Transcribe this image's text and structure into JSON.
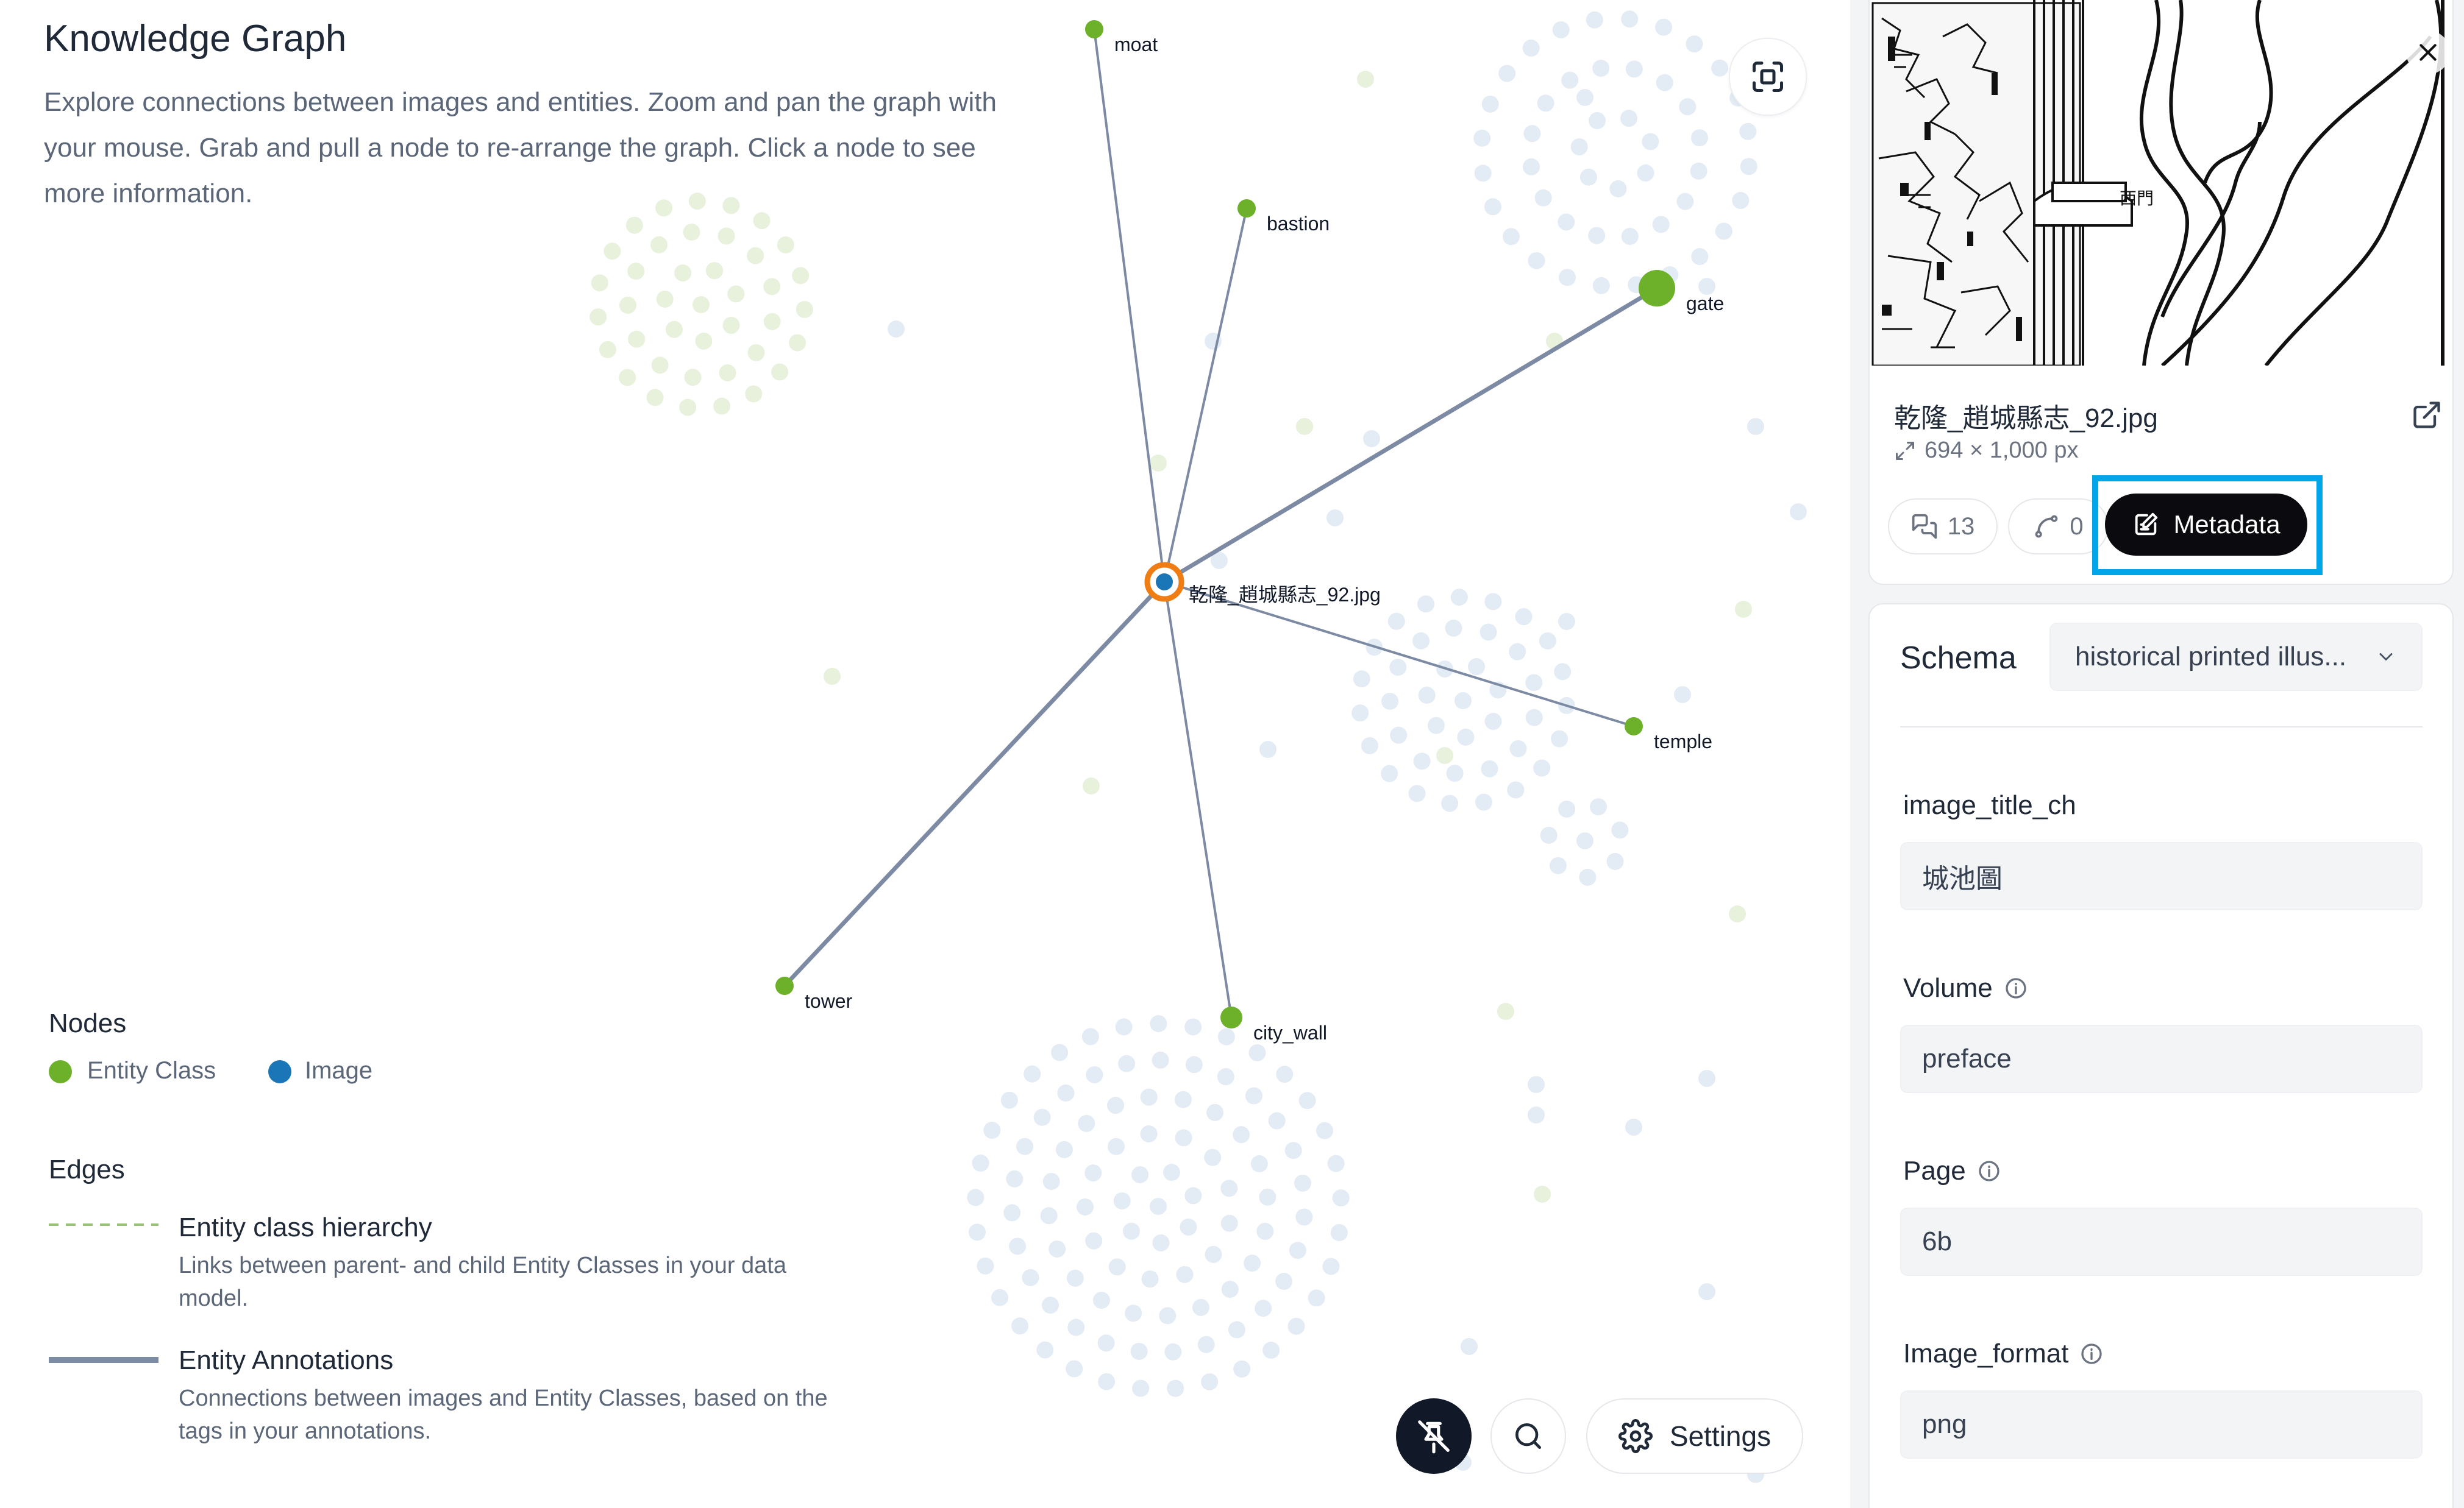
{
  "header": {
    "title": "Knowledge Graph",
    "description": "Explore connections between images and entities. Zoom and pan the graph with your mouse. Grab and pull a node to re-arrange the graph. Click a node to see more information."
  },
  "graph": {
    "center_node": {
      "label": "乾隆_趙城縣志_92.jpg",
      "type": "Image"
    },
    "entity_nodes": [
      {
        "label": "moat"
      },
      {
        "label": "bastion"
      },
      {
        "label": "gate"
      },
      {
        "label": "temple"
      },
      {
        "label": "city_wall"
      },
      {
        "label": "tower"
      }
    ]
  },
  "legend": {
    "nodes_heading": "Nodes",
    "entity_class_label": "Entity Class",
    "image_label": "Image",
    "edges_heading": "Edges",
    "hierarchy_title": "Entity class hierarchy",
    "hierarchy_desc": "Links between parent- and child Entity Classes in your data model.",
    "annotations_title": "Entity Annotations",
    "annotations_desc": "Connections between images and Entity Classes, based on the tags in your annotations."
  },
  "toolbar": {
    "settings_label": "Settings"
  },
  "image_panel": {
    "filename": "乾隆_趙城縣志_92.jpg",
    "dimensions": "694 × 1,000 px",
    "comments_count": "13",
    "relations_count": "0",
    "metadata_label": "Metadata"
  },
  "metadata": {
    "schema_label": "Schema",
    "schema_value": "historical printed illus...",
    "fields": [
      {
        "label": "image_title_ch",
        "value": "城池圖"
      },
      {
        "label": "Volume",
        "value": "preface"
      },
      {
        "label": "Page",
        "value": "6b"
      },
      {
        "label": "Image_format",
        "value": "png"
      }
    ]
  },
  "colors": {
    "entity_node": "#6db12a",
    "image_node": "#1b76b8",
    "selected_ring": "#f07d14",
    "edge": "#7d8aa3",
    "highlight": "#00a6e8",
    "background_dot_blue": "#e3ebf5",
    "background_dot_green": "#e8f1dc"
  },
  "icons": {
    "focus": "focus-frame-icon",
    "pin": "pin-off-icon",
    "search": "search-icon",
    "settings": "gear-icon",
    "close": "close-icon",
    "external": "open-external-icon",
    "resize": "resize-arrows-icon",
    "comments": "comments-icon",
    "relations": "relations-icon",
    "metadata": "edit-note-icon",
    "chevron": "chevron-down-icon",
    "info": "info-icon"
  }
}
